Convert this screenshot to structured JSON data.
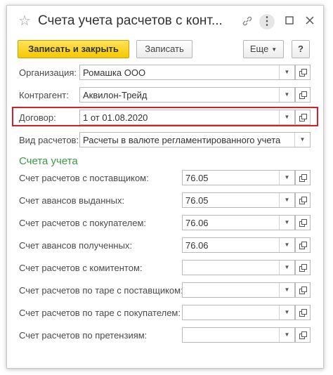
{
  "window": {
    "title": "Счета учета расчетов с конт..."
  },
  "toolbar": {
    "save_close_label": "Записать и закрыть",
    "save_label": "Записать",
    "more_label": "Еще",
    "help_label": "?"
  },
  "form": {
    "org_label": "Организация:",
    "org_value": "Ромашка ООО",
    "contractor_label": "Контрагент:",
    "contractor_value": "Аквилон-Трейд",
    "contract_label": "Договор:",
    "contract_value": "1 от 01.08.2020",
    "calc_type_label": "Вид расчетов:",
    "calc_type_value": "Расчеты в валюте регламентированного учета"
  },
  "accounts": {
    "section_title": "Счета учета",
    "rows": [
      {
        "label": "Счет расчетов с поставщиком:",
        "value": "76.05"
      },
      {
        "label": "Счет авансов выданных:",
        "value": "76.05"
      },
      {
        "label": "Счет расчетов с покупателем:",
        "value": "76.06"
      },
      {
        "label": "Счет авансов полученных:",
        "value": "76.06"
      },
      {
        "label": "Счет расчетов с комитентом:",
        "value": ""
      },
      {
        "label": "Счет расчетов по таре с поставщиком:",
        "value": ""
      },
      {
        "label": "Счет расчетов по таре с покупателем:",
        "value": ""
      },
      {
        "label": "Счет расчетов по претензиям:",
        "value": ""
      }
    ]
  },
  "colors": {
    "primary_button": "#f5c800",
    "highlight_border": "#d4202a",
    "section_title": "#3a9a46"
  },
  "icons": [
    "star-icon",
    "link-icon",
    "more-vertical-icon",
    "maximize-icon",
    "close-icon",
    "dropdown-arrow-icon",
    "open-form-icon"
  ]
}
